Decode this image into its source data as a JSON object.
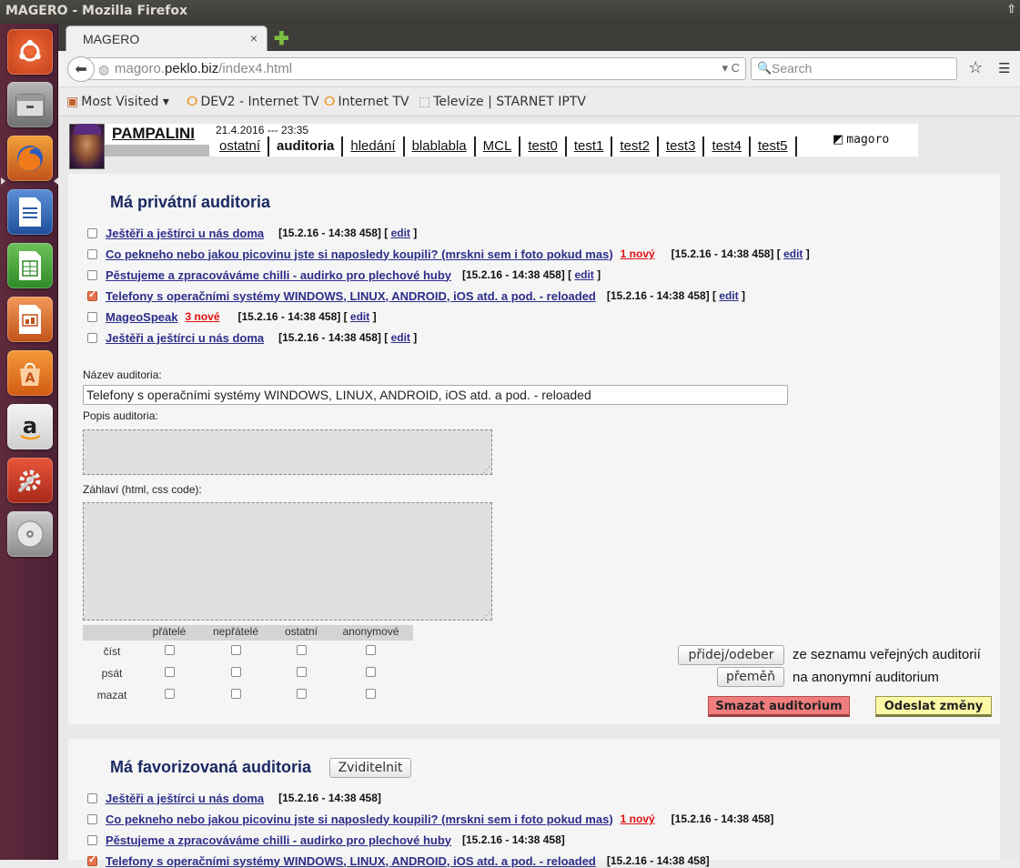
{
  "window": {
    "title": "MAGERO - Mozilla Firefox"
  },
  "tab": {
    "title": "MAGERO",
    "close": "×",
    "new_tab": "✚"
  },
  "nav": {
    "url_prefix": "magoro.",
    "url_host": "peklo.biz",
    "url_path": "/index4.html",
    "url_controls": "▾ C",
    "search_placeholder": "Search"
  },
  "bookmarks": [
    {
      "label": "Most Visited ▾",
      "icon": "folder-icon"
    },
    {
      "label": "DEV2 - Internet TV",
      "icon": "tv-icon"
    },
    {
      "label": "Internet TV",
      "icon": "tv-icon"
    },
    {
      "label": "Televize | STARNET IPTV",
      "icon": "page-icon"
    }
  ],
  "header": {
    "username": "PAMPALINI",
    "datetime": "21.4.2016 --- 23:35",
    "menu": [
      "ostatní",
      "auditoria",
      "hledání",
      "blablabla",
      "MCL",
      "test0",
      "test1",
      "test2",
      "test3",
      "test4",
      "test5"
    ],
    "active_menu": "auditoria",
    "logo_mark": "◩",
    "logo_text": "magoro"
  },
  "private": {
    "title": "Má privátní auditoria",
    "items": [
      {
        "title": "Ještěři a ještírci u nás doma",
        "badge": "",
        "meta": "[15.2.16 - 14:38 458]",
        "edit": "edit",
        "checked": false
      },
      {
        "title": "Co pekneho nebo jakou picovinu jste si naposledy koupili? (mrskni sem i foto pokud mas)",
        "badge": "1 nový",
        "meta": "[15.2.16 - 14:38 458]",
        "edit": "edit",
        "checked": false
      },
      {
        "title": "Pěstujeme a zpracováváme chilli - audirko pro plechové huby",
        "badge": "",
        "meta": "[15.2.16 - 14:38 458]",
        "edit": "edit",
        "checked": false
      },
      {
        "title": "Telefony s operačními systémy WINDOWS, LINUX, ANDROID, iOS atd. a pod. - reloaded",
        "badge": "",
        "meta": "[15.2.16 - 14:38 458]",
        "edit": "edit",
        "checked": true
      },
      {
        "title": "MageoSpeak",
        "badge": "3 nové",
        "meta": "[15.2.16 - 14:38 458]",
        "edit": "edit",
        "checked": false
      },
      {
        "title": "Ještěři a ještírci u nás doma",
        "badge": "",
        "meta": "[15.2.16 - 14:38 458]",
        "edit": "edit",
        "checked": false
      }
    ]
  },
  "form": {
    "name_label": "Název auditoria:",
    "name_value": "Telefony s operačními systémy WINDOWS, LINUX, ANDROID, iOS atd. a pod. - reloaded",
    "desc_label": "Popis auditoria:",
    "header_label": "Záhlaví (html, css code):",
    "perm_columns": [
      "přátelé",
      "nepřátelé",
      "ostatní",
      "anonymové"
    ],
    "perm_rows": [
      "číst",
      "psát",
      "mazat"
    ],
    "btn_add": "přidej/odeber",
    "btn_add_text": "ze seznamu veřejných auditorií",
    "btn_rename": "přeměň",
    "btn_rename_text": "na anonymní auditorium",
    "btn_delete": "Smazat auditorium",
    "btn_send": "Odeslat změny"
  },
  "favorites": {
    "title": "Má favorizovaná auditoria",
    "toggle": "Zviditelnit",
    "items": [
      {
        "title": "Ještěři a ještírci u nás doma",
        "badge": "",
        "meta": "[15.2.16 - 14:38 458]",
        "checked": false
      },
      {
        "title": "Co pekneho nebo jakou picovinu jste si naposledy koupili? (mrskni sem i foto pokud mas)",
        "badge": "1 nový",
        "meta": "[15.2.16 - 14:38 458]",
        "checked": false
      },
      {
        "title": "Pěstujeme a zpracováváme chilli - audirko pro plechové huby",
        "badge": "",
        "meta": "[15.2.16 - 14:38 458]",
        "checked": false
      },
      {
        "title": "Telefony s operačními systémy WINDOWS, LINUX, ANDROID, iOS atd. a pod. - reloaded",
        "badge": "",
        "meta": "[15.2.16 - 14:38 458]",
        "checked": true
      }
    ]
  }
}
